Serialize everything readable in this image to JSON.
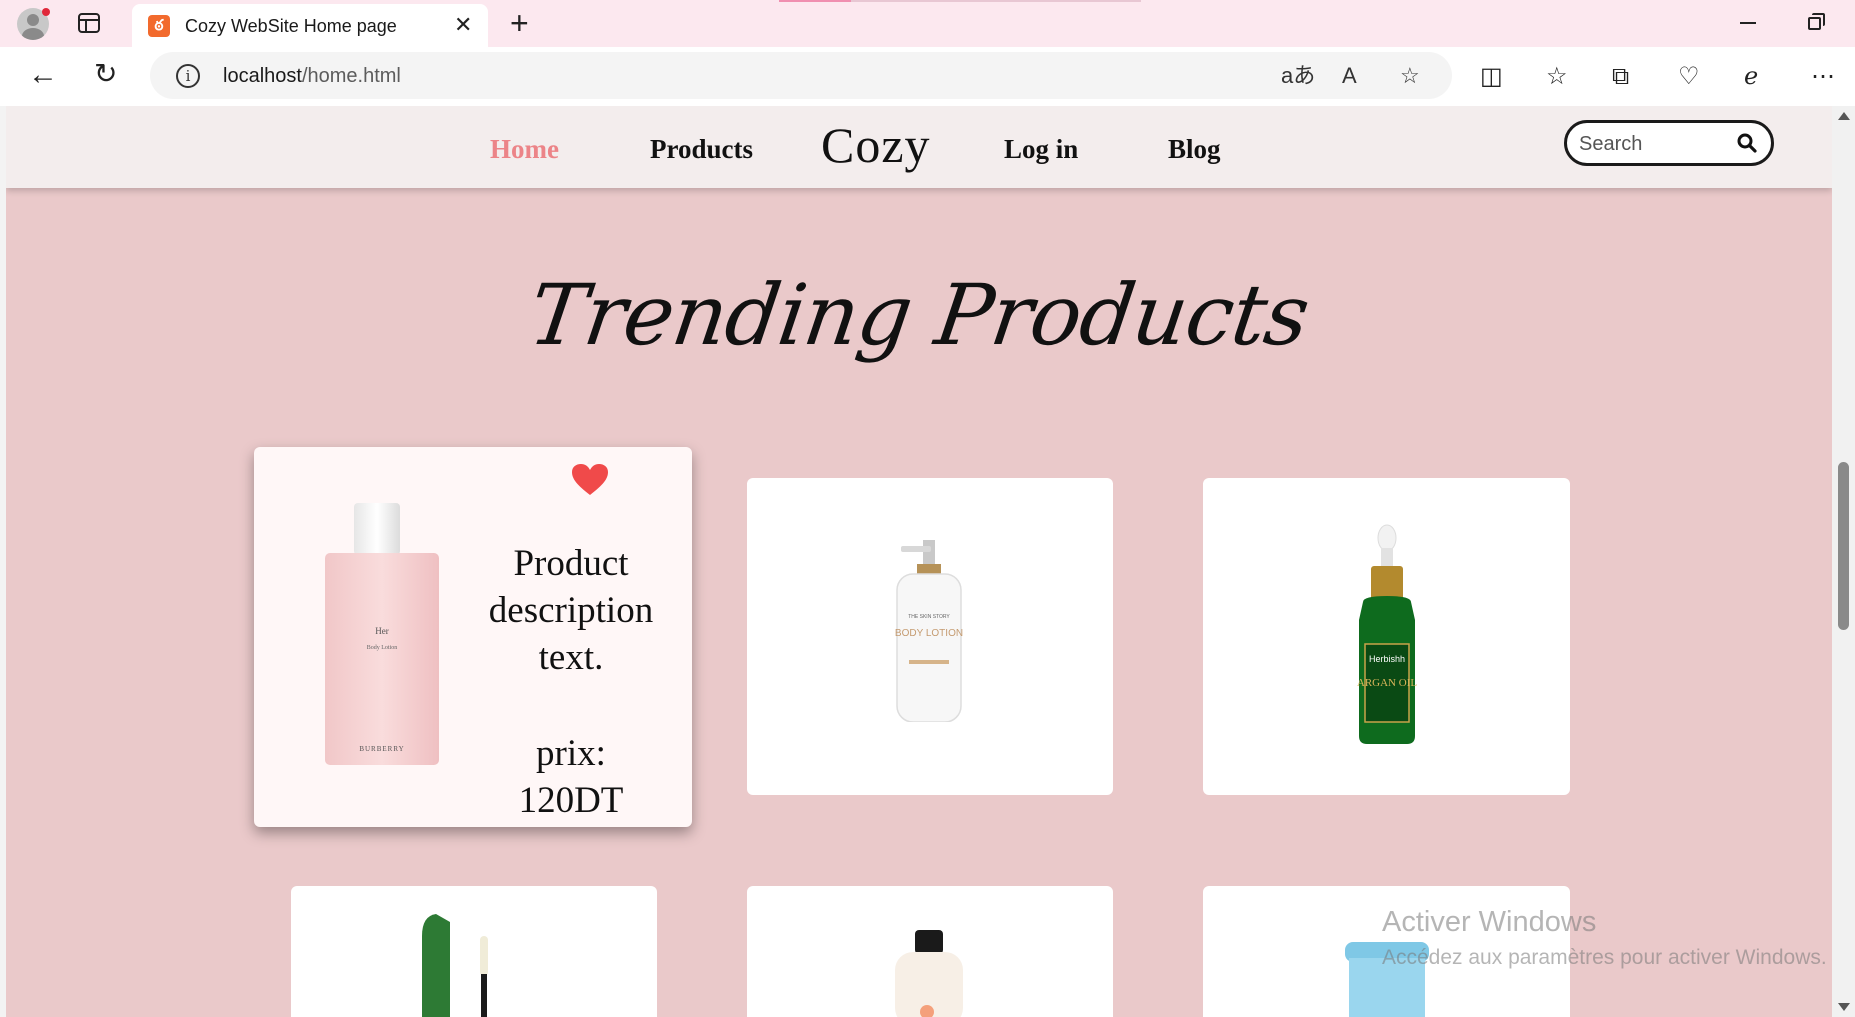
{
  "browser": {
    "tab_title": "Cozy WebSite Home page",
    "url_host": "localhost",
    "url_path": "/home.html",
    "tab_favicon_glyph": "ఠ"
  },
  "site": {
    "nav": {
      "home": "Home",
      "products": "Products",
      "logo": "Cozy",
      "login": "Log in",
      "blog": "Blog"
    },
    "search": {
      "placeholder": "Search"
    },
    "section_title": "Trending Products",
    "featured_card": {
      "description": "Product description text.",
      "price": "prix: 120DT"
    },
    "products_first_row": [
      {
        "name": "Her Body Lotion",
        "brand": "BURBERRY"
      },
      {
        "name": "Body Lotion",
        "brand": "THE SKIN STORY"
      },
      {
        "name": "Argan Oil",
        "brand": "Herbishh"
      }
    ]
  },
  "images_text": {
    "her_label": "Her",
    "body_lotion_small": "Body Lotion",
    "burberry": "BURBERRY",
    "skin_story": "THE SKIN STORY",
    "body_lotion_big": "BODY LOTION",
    "herbishh": "Herbishh",
    "argan_oil": "ARGAN OIL"
  },
  "watermark": {
    "title": "Activer Windows",
    "subtitle": "Accédez aux paramètres pour activer Windows."
  },
  "colors": {
    "accent_active_link": "#ec8488",
    "page_background": "#eac9ca",
    "nav_background": "#f3eded",
    "heart": "#f04a4a"
  }
}
